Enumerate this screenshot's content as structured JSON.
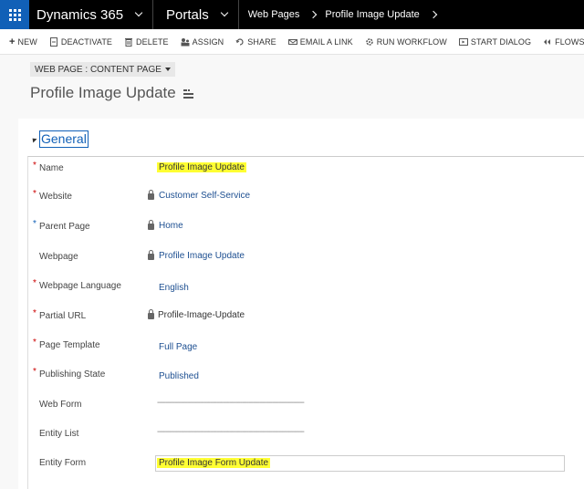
{
  "topbar": {
    "app_name": "Dynamics 365",
    "area_name": "Portals",
    "breadcrumb": [
      "Web Pages",
      "Profile Image Update"
    ]
  },
  "commands": [
    {
      "label": "NEW",
      "icon": "plus-icon"
    },
    {
      "label": "DEACTIVATE",
      "icon": "deactivate-icon"
    },
    {
      "label": "DELETE",
      "icon": "trash-icon"
    },
    {
      "label": "ASSIGN",
      "icon": "assign-icon"
    },
    {
      "label": "SHARE",
      "icon": "share-icon"
    },
    {
      "label": "EMAIL A LINK",
      "icon": "email-icon"
    },
    {
      "label": "RUN WORKFLOW",
      "icon": "workflow-icon"
    },
    {
      "label": "START DIALOG",
      "icon": "dialog-icon"
    },
    {
      "label": "FLOWS",
      "icon": "flows-icon"
    }
  ],
  "header": {
    "form_selector": "WEB PAGE : CONTENT PAGE",
    "record_title": "Profile Image Update"
  },
  "section": {
    "title": "General"
  },
  "fields": [
    {
      "label": "Name",
      "value": "Profile Image Update"
    },
    {
      "label": "Website",
      "value": "Customer Self-Service"
    },
    {
      "label": "Parent Page",
      "value": "Home"
    },
    {
      "label": "Webpage",
      "value": "Profile Image Update"
    },
    {
      "label": "Webpage Language",
      "value": "English"
    },
    {
      "label": "Partial URL",
      "value": "Profile-Image-Update"
    },
    {
      "label": "Page Template",
      "value": "Full Page"
    },
    {
      "label": "Publishing State",
      "value": "Published"
    },
    {
      "label": "Web Form",
      "value": "---------------------------------------------------------------------"
    },
    {
      "label": "Entity List",
      "value": "---------------------------------------------------------------------"
    },
    {
      "label": "Entity Form",
      "value": "Profile Image Form Update"
    }
  ],
  "colors": {
    "waffle_bg": "#1160b7",
    "highlight": "#ffff33",
    "required_marker": "#c00000",
    "link_text": "#1d4f91"
  }
}
